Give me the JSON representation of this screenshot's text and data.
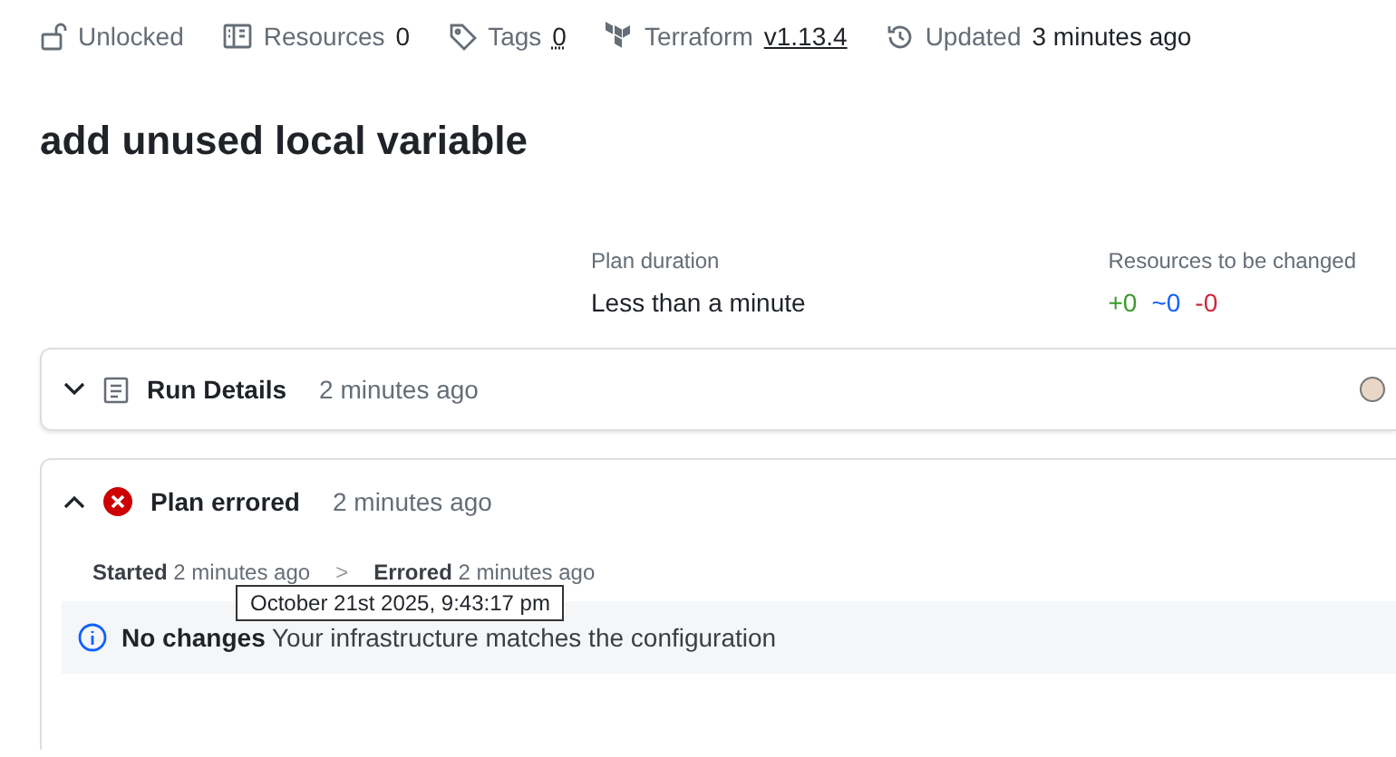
{
  "meta": [
    {
      "kind": "lock",
      "label": "Unlocked"
    },
    {
      "kind": "resources",
      "label": "Resources",
      "value": "0"
    },
    {
      "kind": "tags",
      "label": "Tags",
      "value": "0"
    },
    {
      "kind": "terraform",
      "label": "Terraform",
      "value": "v1.13.4"
    },
    {
      "kind": "updated",
      "label": "Updated",
      "value": "3 minutes ago"
    }
  ],
  "title": "add unused local variable",
  "stats": {
    "duration_label": "Plan duration",
    "duration": "Less than a minute",
    "changes_label": "Resources to be changed",
    "add": "+0",
    "change": "~0",
    "destroy": "-0"
  },
  "run_details": {
    "title": "Run Details",
    "time": "2 minutes ago",
    "expanded": false
  },
  "plan": {
    "title": "Plan errored",
    "time": "2 minutes ago",
    "expanded": true,
    "started_label": "Started",
    "started": "2 minutes ago",
    "separator": ">",
    "errored_label": "Errored",
    "errored": "2 minutes ago",
    "tooltip": "October 21st 2025, 9:43:17 pm",
    "notice_title": "No changes",
    "notice_text": "Your infrastructure matches the configuration"
  }
}
